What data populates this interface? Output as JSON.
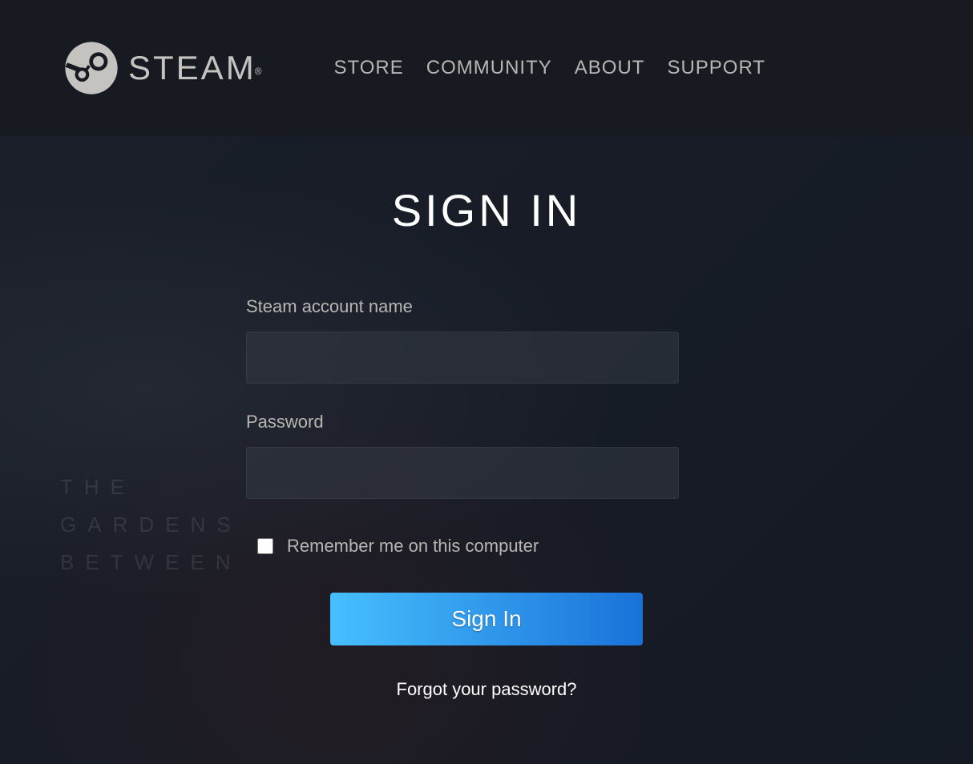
{
  "header": {
    "brand": "STEAM",
    "nav": [
      {
        "id": "store",
        "label": "STORE"
      },
      {
        "id": "community",
        "label": "COMMUNITY"
      },
      {
        "id": "about",
        "label": "ABOUT"
      },
      {
        "id": "support",
        "label": "SUPPORT"
      }
    ]
  },
  "page": {
    "title": "SIGN IN"
  },
  "form": {
    "account_label": "Steam account name",
    "account_value": "",
    "password_label": "Password",
    "password_value": "",
    "remember_label": "Remember me on this computer",
    "remember_checked": false,
    "submit_label": "Sign In",
    "forgot_label": "Forgot your password?"
  },
  "background": {
    "decorative_text": "THE\nGARDENS\nBETWEEN"
  }
}
